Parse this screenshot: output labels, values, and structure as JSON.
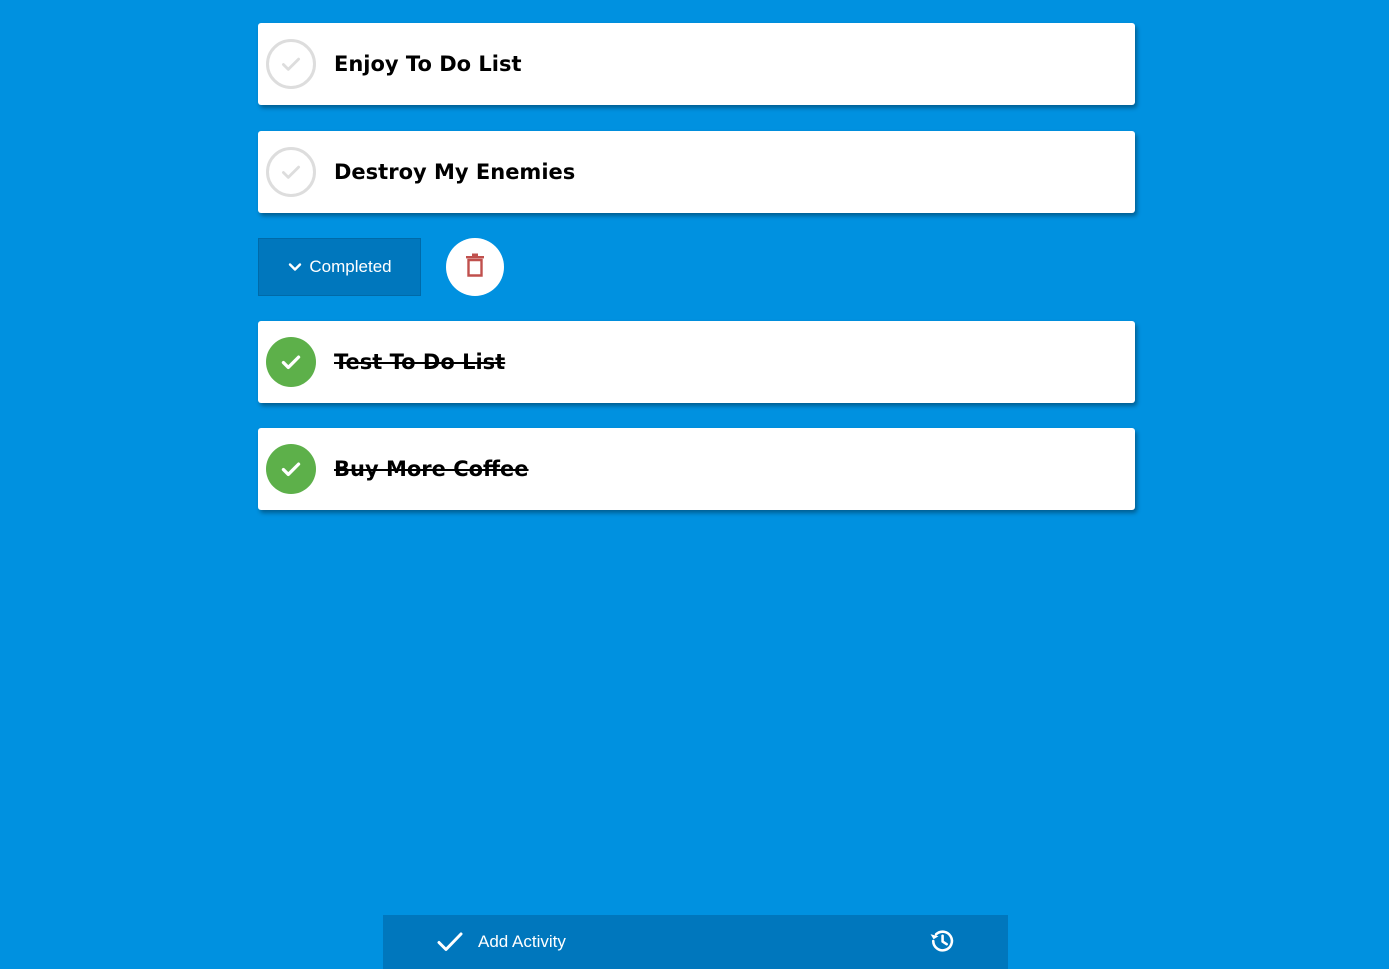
{
  "todos": {
    "open": [
      {
        "text": "Enjoy To Do List",
        "icon": "check-circle-outline-icon"
      },
      {
        "text": "Destroy My Enemies",
        "icon": "check-circle-outline-icon"
      }
    ],
    "completed": [
      {
        "text": "Test To Do List",
        "icon": "check-circle-filled-icon"
      },
      {
        "text": "Buy More Coffee",
        "icon": "check-circle-filled-icon"
      }
    ]
  },
  "completed_section": {
    "toggle_label": "Completed",
    "toggle_icon": "chevron-down-icon",
    "delete_icon": "trash-icon"
  },
  "bottom_bar": {
    "add_label": "Add Activity",
    "add_icon": "checkmark-icon",
    "history_icon": "history-icon"
  },
  "colors": {
    "background": "#0091e0",
    "bar": "#0077bd",
    "done_green": "#5db04a",
    "trash_red": "#c0504d",
    "open_ring": "#dddddd"
  }
}
